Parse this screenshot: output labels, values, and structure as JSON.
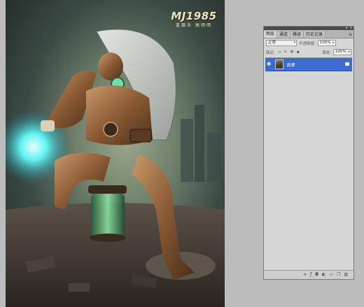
{
  "watermark": {
    "title": "MJ1985",
    "subtitle": "蓝猫乐 高明明"
  },
  "layers_panel": {
    "tabs": [
      {
        "label": "图层",
        "active": true
      },
      {
        "label": "通道",
        "active": false
      },
      {
        "label": "路径",
        "active": false
      },
      {
        "label": "历史记录",
        "active": false
      }
    ],
    "tab_menu_icon": "panel-menu-icon",
    "blend_mode": "正常",
    "opacity_label": "不透明度:",
    "opacity_value": "100%",
    "lock_label": "锁定:",
    "fill_label": "填充:",
    "fill_value": "100%",
    "layers": [
      {
        "name": "背景",
        "visible": true,
        "selected": true,
        "locked": true
      }
    ],
    "bottom_icons": [
      "link-icon",
      "fx-icon",
      "mask-icon",
      "adjustment-icon",
      "group-icon",
      "new-layer-icon",
      "trash-icon"
    ]
  },
  "colors": {
    "selection": "#3c6cd0",
    "panel_bg": "#d6d6d6",
    "workspace": "#bcbcbc"
  }
}
